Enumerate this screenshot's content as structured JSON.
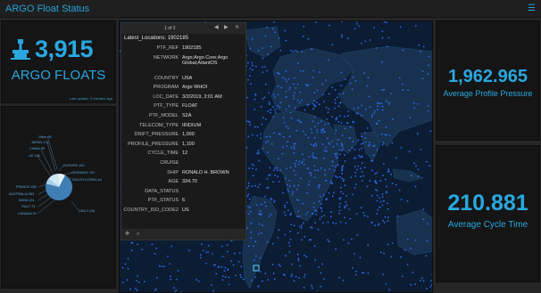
{
  "header": {
    "title": "ARGO Float Status",
    "menu_icon": "hamburger-icon"
  },
  "floats": {
    "count": "3,915",
    "label": "ARGO FLOATS",
    "last_update": "Last update: 3 minutes ago",
    "icon": "float-icon"
  },
  "pie": {
    "colors": {
      "dominant": "#3f7fb5",
      "light": "#cfe6f5"
    },
    "labels": [
      "Other 90",
      "JAPAN 174",
      "CHINA 95",
      "UK 146",
      "FRANCE 280",
      "AUSTRALIA 362",
      "INDIA 124",
      "ITALY 73",
      "CANADA 91",
      "EUROPE 120",
      "GERMANY 157",
      "SOUTH KOREA 44",
      "USA 2,126"
    ]
  },
  "popup": {
    "pager": "1 of 2",
    "title": "Latest_Locations: 1902185",
    "fields": [
      {
        "key": "PTF_REF",
        "value": "1902185"
      },
      {
        "key": "NETWORK",
        "value": "Argo;Argo Core;Argo Global;AtlantOS"
      },
      {
        "key": "COUNTRY",
        "value": "USA"
      },
      {
        "key": "PROGRAM",
        "value": "Argo WHOI"
      },
      {
        "key": "LOC_DATE",
        "value": "3/2/2019, 2:01 AM"
      },
      {
        "key": "PTF_TYPE",
        "value": "FLOAT"
      },
      {
        "key": "PTF_MODEL",
        "value": "S2A"
      },
      {
        "key": "TELECOM_TYPE",
        "value": "IRIDIUM"
      },
      {
        "key": "DRIFT_PRESSURE",
        "value": "1,000"
      },
      {
        "key": "PROFILE_PRESSURE",
        "value": "1,100"
      },
      {
        "key": "CYCLE_TIME",
        "value": "12"
      },
      {
        "key": "CRUISE",
        "value": ""
      },
      {
        "key": "SHIP",
        "value": "RONALD H. BROWN"
      },
      {
        "key": "AGE",
        "value": "334.70"
      },
      {
        "key": "DATA_STATUS",
        "value": ""
      },
      {
        "key": "PTF_STATUS",
        "value": "6"
      },
      {
        "key": "COUNTRY_ISO_CODE2",
        "value": "US"
      }
    ]
  },
  "pressure": {
    "value": "1,962.965",
    "label": "Average Profile Pressure"
  },
  "cycle": {
    "value": "210.881",
    "label": "Average Cycle Time"
  },
  "colors": {
    "accent": "#29a8e0",
    "panel_bg": "#151515",
    "map_bg": "#0b1c33",
    "float_dot": "#2f6df0"
  }
}
